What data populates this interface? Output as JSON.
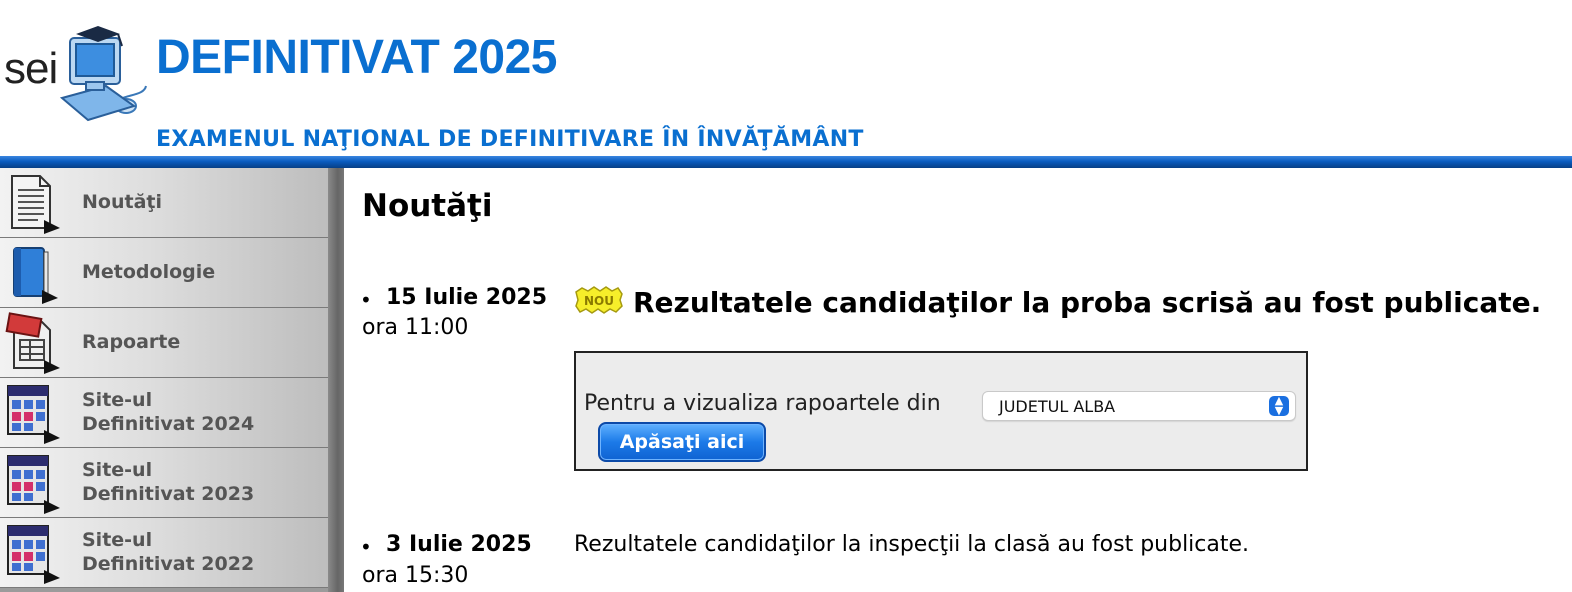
{
  "header": {
    "logo_text": "sei",
    "title": "DEFINITIVAT 2025",
    "subtitle": "EXAMENUL NAŢIONAL DE DEFINITIVARE ÎN ÎNVĂŢĂMÂNT"
  },
  "sidebar": {
    "items": [
      {
        "label": "Noutăţi",
        "icon": "document-icon"
      },
      {
        "label": "Metodologie",
        "icon": "book-icon"
      },
      {
        "label": "Rapoarte",
        "icon": "report-icon"
      },
      {
        "label_line1": "Site-ul",
        "label_line2": "Definitivat 2024",
        "icon": "site-archive-icon"
      },
      {
        "label_line1": "Site-ul",
        "label_line2": "Definitivat 2023",
        "icon": "site-archive-icon"
      },
      {
        "label_line1": "Site-ul",
        "label_line2": "Definitivat 2022",
        "icon": "site-archive-icon"
      }
    ]
  },
  "main": {
    "title": "Noutăţi",
    "news": [
      {
        "date": "15 Iulie 2025",
        "time": "ora 11:00",
        "badge": "NOU",
        "headline": "Rezultatele candidaţilor la proba scrisă au fost publicate.",
        "report_prompt": "Pentru a vizualiza rapoartele din",
        "county_selected": "JUDETUL ALBA",
        "button_label": "Apăsaţi aici"
      },
      {
        "date": "3 Iulie 2025",
        "time": "ora 15:30",
        "headline": "Rezultatele candidaţilor la inspecţii la clasă au fost publicate."
      }
    ]
  },
  "colors": {
    "brand_blue": "#0a6fd0",
    "button_blue": "#1c7ae8",
    "sidebar_gray": "#9b9b9b"
  }
}
